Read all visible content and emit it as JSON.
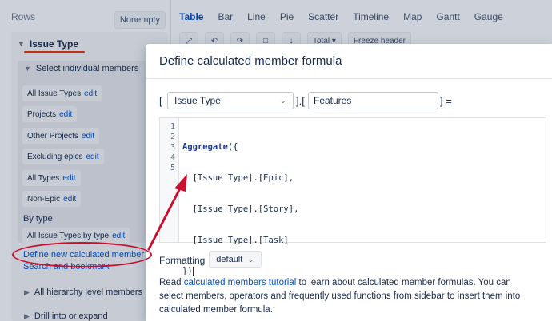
{
  "sidebar": {
    "title": "Rows",
    "nonempty_label": "Nonempty",
    "dimension": "Issue Type",
    "section_select": "Select individual members",
    "members": [
      {
        "name": "All Issue Types",
        "edit": "edit"
      },
      {
        "name": "Projects",
        "edit": "edit"
      },
      {
        "name": "Other Projects",
        "edit": "edit"
      },
      {
        "name": "Excluding epics",
        "edit": "edit"
      },
      {
        "name": "All Types",
        "edit": "edit"
      },
      {
        "name": "Non-Epic",
        "edit": "edit"
      }
    ],
    "by_type_label": "By type",
    "by_type_member": {
      "name": "All Issue Types by type",
      "edit": "edit"
    },
    "define_new_label": "Define new calculated member",
    "search_label": "Search and bookmark",
    "section_hierarchy": "All hierarchy level members",
    "section_drill": "Drill into or expand"
  },
  "tabs": [
    "Table",
    "Bar",
    "Line",
    "Pie",
    "Scatter",
    "Timeline",
    "Map",
    "Gantt",
    "Gauge"
  ],
  "active_tab": "Table",
  "toolbar": {
    "total_label": "Total",
    "freeze_label": "Freeze header"
  },
  "dialog": {
    "title": "Define calculated member formula",
    "dimension_value": "Issue Type",
    "member_name": "Features",
    "bracket_open": "[",
    "bracket_mid": "].[",
    "bracket_close": "] =",
    "line_numbers": [
      "1",
      "2",
      "3",
      "4",
      "5"
    ],
    "code": {
      "l1_fn": "Aggregate",
      "l1_rest": "({",
      "l2": "  [Issue Type].[Epic],",
      "l3": "  [Issue Type].[Story],",
      "l4": "  [Issue Type].[Task]",
      "l5": "})"
    },
    "formatting_label": "Formatting",
    "formatting_value": "default",
    "help_prefix": "Read ",
    "help_link": "calculated members tutorial",
    "help_suffix": " to learn about calculated member formulas. You can select members, operators and frequently used functions from sidebar to insert them into calculated member formula."
  },
  "colors": {
    "accent": "#0052cc",
    "annotation": "#c8102e"
  },
  "icons": [
    "chevron-down-icon",
    "chevron-right-icon",
    "expand-icon",
    "undo-icon",
    "redo-icon",
    "comment-icon",
    "download-icon"
  ]
}
